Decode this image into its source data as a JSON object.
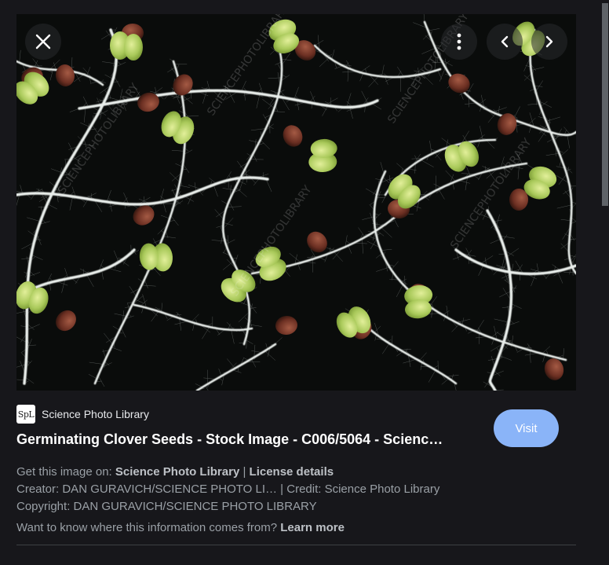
{
  "controls": {
    "close_icon": "close-icon",
    "more_icon": "more-vert-icon",
    "prev_icon": "chevron-left-icon",
    "next_icon": "chevron-right-icon"
  },
  "source": {
    "favicon_text": "SpL",
    "name": "Science Photo Library"
  },
  "title": "Germinating Clover Seeds - Stock Image - C006/5064 - Scienc…",
  "visit_label": "Visit",
  "meta": {
    "get_image_prefix": "Get this image on: ",
    "get_image_link": "Science Photo Library",
    "separator": " | ",
    "license_link": "License details",
    "creator": "Creator: DAN GURAVICH/SCIENCE PHOTO LI… | Credit: Science Photo Library",
    "copyright": "Copyright: DAN GURAVICH/SCIENCE PHOTO LIBRARY",
    "info_prefix": "Want to know where this information comes from? ",
    "learn_more": "Learn more"
  },
  "colors": {
    "background": "#17171b",
    "visit_button": "#8ab4f8",
    "seedling_leaf": "#b7d46a",
    "root": "#e6ece8",
    "seed": "#7a3b2a"
  }
}
